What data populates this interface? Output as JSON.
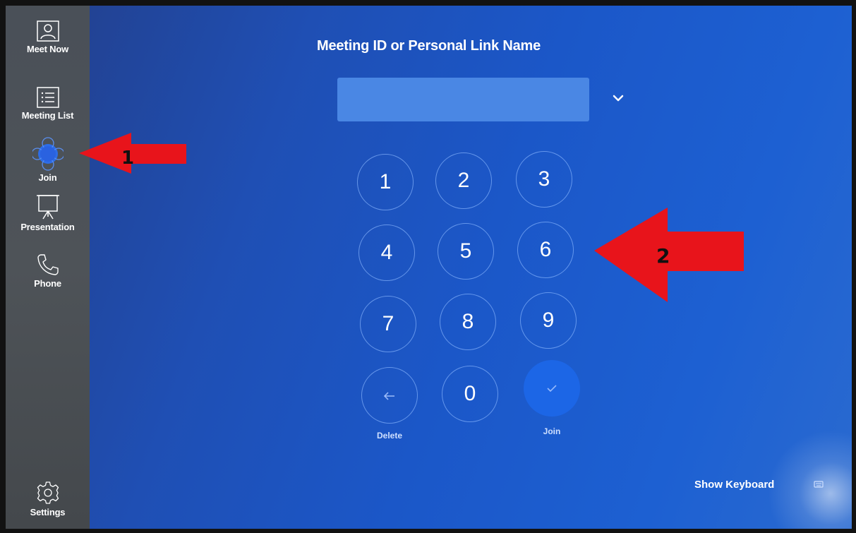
{
  "sidebar": {
    "items": [
      {
        "label": "Meet Now",
        "icon": "person-card-icon"
      },
      {
        "label": "Meeting List",
        "icon": "list-icon"
      },
      {
        "label": "Join",
        "icon": "join-icon",
        "active": true
      },
      {
        "label": "Presentation",
        "icon": "projector-screen-icon"
      },
      {
        "label": "Phone",
        "icon": "phone-icon"
      }
    ],
    "settings": {
      "label": "Settings",
      "icon": "gear-icon"
    }
  },
  "main": {
    "title": "Meeting ID or Personal Link Name",
    "input": {
      "value": "",
      "placeholder": ""
    },
    "dropdown_icon": "chevron-down-icon",
    "keypad": {
      "digits": [
        "1",
        "2",
        "3",
        "4",
        "5",
        "6",
        "7",
        "8",
        "9",
        "0"
      ],
      "delete_label": "Delete",
      "join_label": "Join",
      "delete_icon": "back-arrow-icon",
      "join_icon": "checkmark-icon"
    },
    "show_keyboard_label": "Show Keyboard",
    "keyboard_icon": "keyboard-icon"
  },
  "annotations": [
    {
      "number": "1",
      "color": "#e8141b"
    },
    {
      "number": "2",
      "color": "#e8141b"
    }
  ],
  "colors": {
    "background": "#1f55c4",
    "sidebar": "#4b5056",
    "input": "#4a87e4",
    "join_button": "#1c66e6",
    "annotation_arrow": "#e8141b"
  }
}
